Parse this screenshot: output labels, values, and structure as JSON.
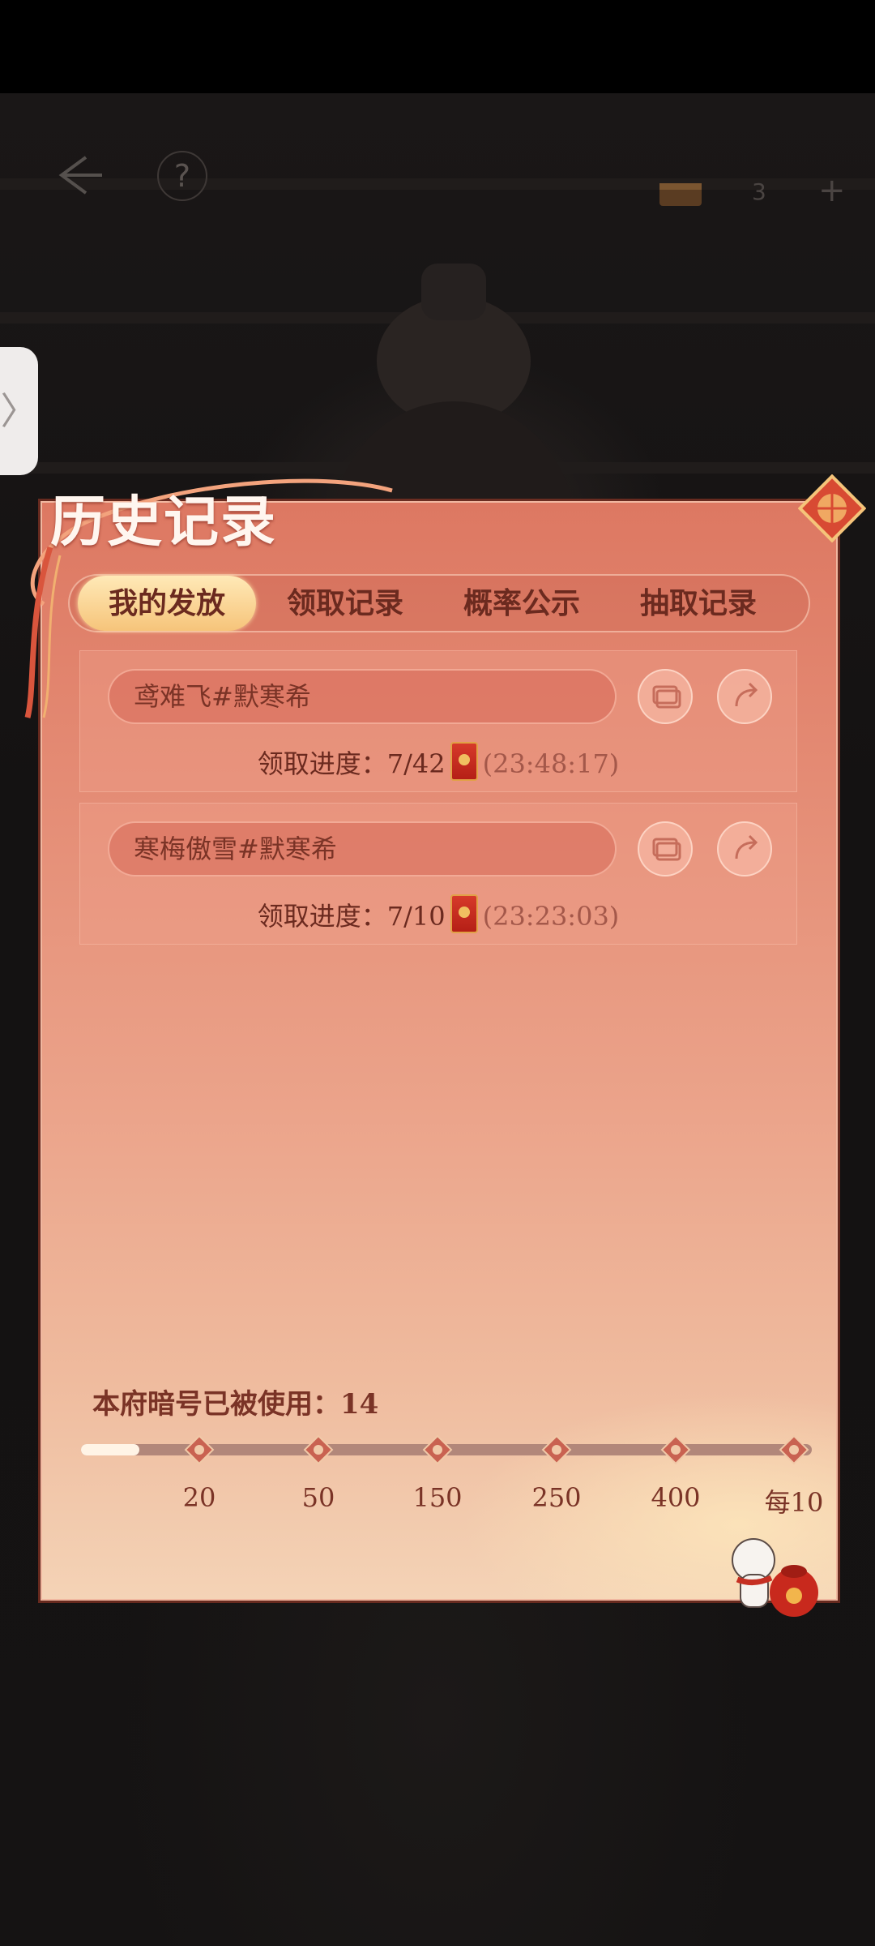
{
  "hud": {
    "back_icon": "back-arrow-icon",
    "help_label": "?",
    "currency_icon": "treasure-chest-icon",
    "currency_value": "3",
    "add_label": "+"
  },
  "side_tab": {
    "label": "〉"
  },
  "panel": {
    "title": "历史记录",
    "tabs": [
      {
        "label": "我的发放",
        "active": true
      },
      {
        "label": "领取记录",
        "active": false
      },
      {
        "label": "概率公示",
        "active": false
      },
      {
        "label": "抽取记录",
        "active": false
      }
    ],
    "records": [
      {
        "name": "鸢难飞#默寒希",
        "progress_label": "领取进度：",
        "progress": "7/42",
        "time": "(23:48:17)"
      },
      {
        "name": "寒梅傲雪#默寒希",
        "progress_label": "领取进度：",
        "progress": "7/10",
        "time": "(23:23:03)"
      }
    ],
    "usage": {
      "text": "本府暗号已被使用：14",
      "count": 14
    },
    "milestones": [
      "20",
      "50",
      "150",
      "250",
      "400",
      "每10"
    ],
    "progress_fraction": 0.08
  },
  "colors": {
    "panel_top": "#dd7862",
    "panel_bottom": "#f4d3b6",
    "tab_active": "#f6c47a",
    "text": "#7a3326"
  }
}
